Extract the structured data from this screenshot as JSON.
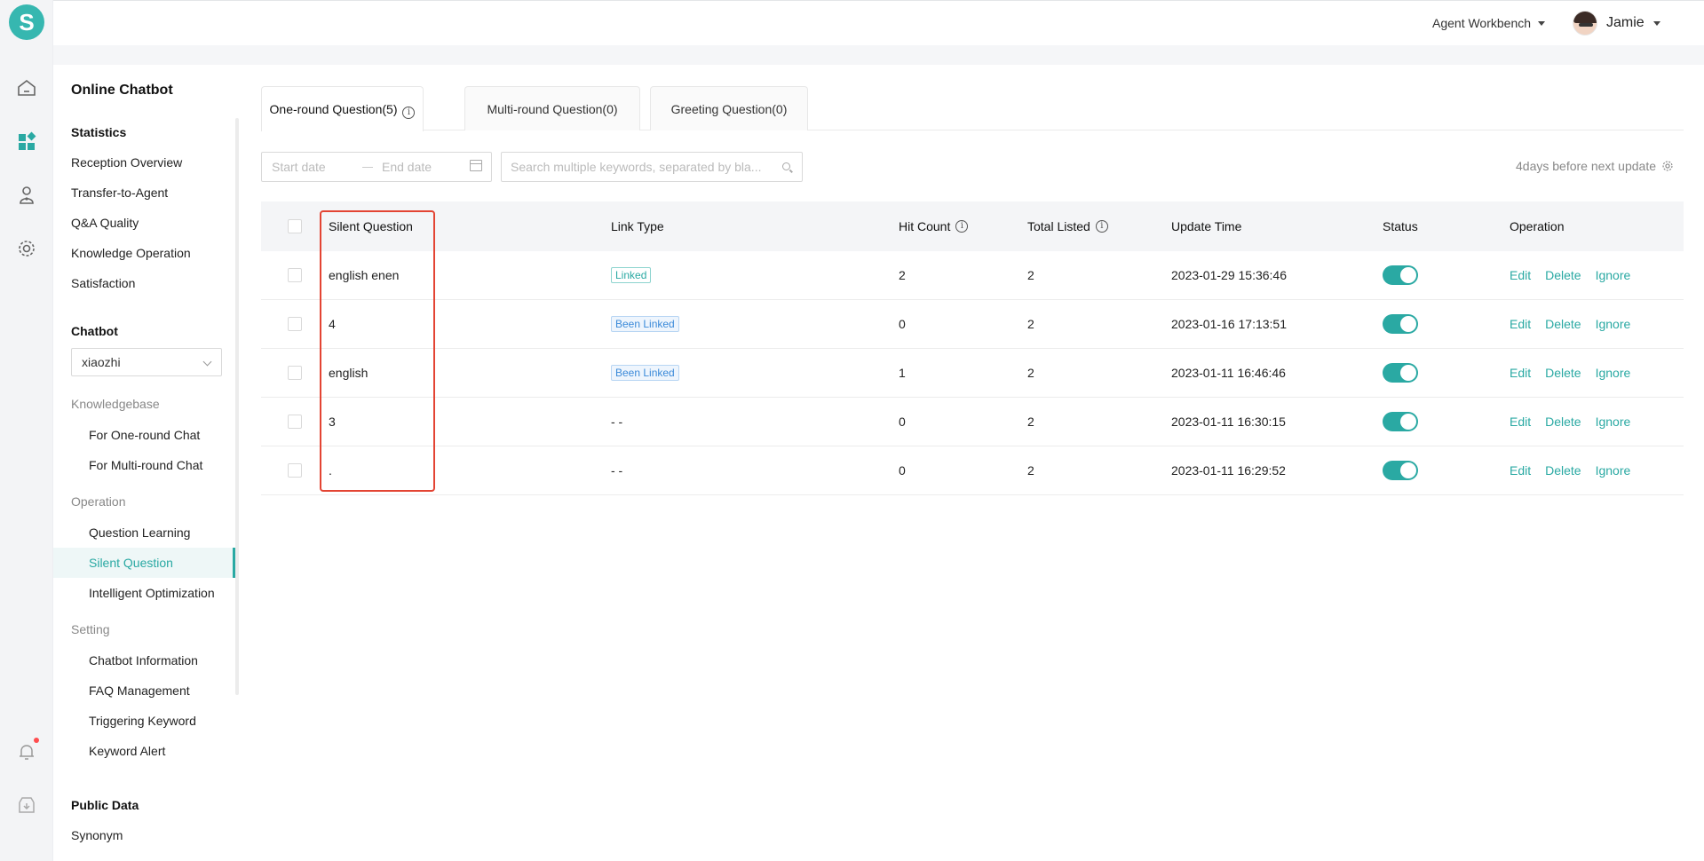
{
  "app": {
    "logo_letter": "S"
  },
  "header": {
    "workbench_label": "Agent Workbench",
    "user_name": "Jamie"
  },
  "sidebar": {
    "title": "Online Chatbot",
    "statistics": {
      "heading": "Statistics",
      "items": [
        "Reception Overview",
        "Transfer-to-Agent",
        "Q&A Quality",
        "Knowledge Operation",
        "Satisfaction"
      ]
    },
    "chatbot": {
      "heading": "Chatbot",
      "selected": "xiaozhi"
    },
    "knowledgebase": {
      "heading": "Knowledgebase",
      "items": [
        "For One-round Chat",
        "For Multi-round Chat"
      ]
    },
    "operation": {
      "heading": "Operation",
      "items": [
        "Question Learning",
        "Silent Question",
        "Intelligent Optimization"
      ],
      "active": "Silent Question"
    },
    "setting": {
      "heading": "Setting",
      "items": [
        "Chatbot Information",
        "FAQ Management",
        "Triggering Keyword",
        "Keyword Alert"
      ]
    },
    "public_data": {
      "heading": "Public Data",
      "items": [
        "Synonym"
      ]
    }
  },
  "tabs": [
    {
      "label": "One-round Question(5)",
      "active": true
    },
    {
      "label": "Multi-round Question(0)",
      "active": false
    },
    {
      "label": "Greeting Question(0)",
      "active": false
    }
  ],
  "filters": {
    "start_placeholder": "Start date",
    "end_placeholder": "End date",
    "search_placeholder": "Search multiple keywords, separated by bla...",
    "update_note": "4days before next update"
  },
  "table": {
    "columns": [
      "Silent Question",
      "Link Type",
      "Hit Count",
      "Total Listed",
      "Update Time",
      "Status",
      "Operation"
    ],
    "rows": [
      {
        "question": "english enen",
        "link_type": "Linked",
        "hit_count": "2",
        "total_listed": "2",
        "update_time": "2023-01-29 15:36:46",
        "status": "on"
      },
      {
        "question": "4",
        "link_type": "Been Linked",
        "hit_count": "0",
        "total_listed": "2",
        "update_time": "2023-01-16 17:13:51",
        "status": "on"
      },
      {
        "question": "english",
        "link_type": "Been Linked",
        "hit_count": "1",
        "total_listed": "2",
        "update_time": "2023-01-11 16:46:46",
        "status": "on"
      },
      {
        "question": "3",
        "link_type": "- -",
        "hit_count": "0",
        "total_listed": "2",
        "update_time": "2023-01-11 16:30:15",
        "status": "on"
      },
      {
        "question": ".",
        "link_type": "- -",
        "hit_count": "0",
        "total_listed": "2",
        "update_time": "2023-01-11 16:29:52",
        "status": "on"
      }
    ],
    "operations": [
      "Edit",
      "Delete",
      "Ignore"
    ]
  },
  "colors": {
    "accent": "#2aa9a3",
    "highlight_box": "#e34433",
    "badge_blue": "#3b8ad9"
  }
}
